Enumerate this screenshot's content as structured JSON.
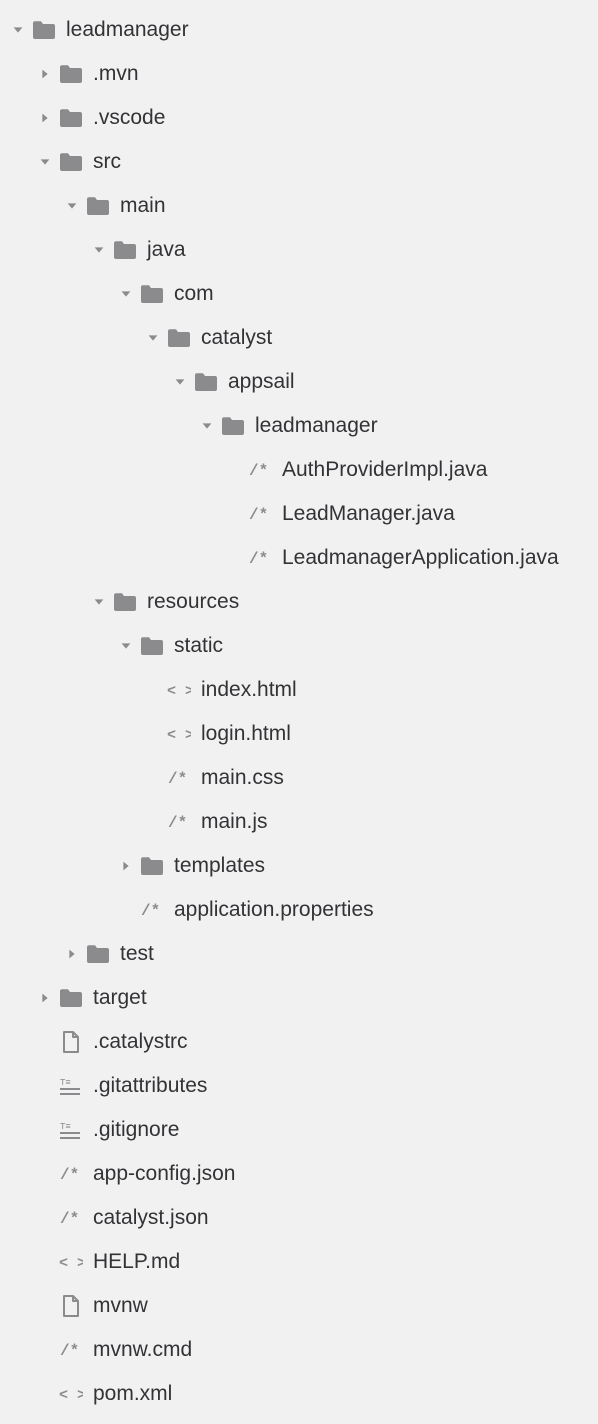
{
  "tree": [
    {
      "depth": 0,
      "expanded": true,
      "icon": "folder",
      "label": "leadmanager"
    },
    {
      "depth": 1,
      "expanded": false,
      "icon": "folder",
      "label": ".mvn"
    },
    {
      "depth": 1,
      "expanded": false,
      "icon": "folder",
      "label": ".vscode"
    },
    {
      "depth": 1,
      "expanded": true,
      "icon": "folder",
      "label": "src"
    },
    {
      "depth": 2,
      "expanded": true,
      "icon": "folder",
      "label": "main"
    },
    {
      "depth": 3,
      "expanded": true,
      "icon": "folder",
      "label": "java"
    },
    {
      "depth": 4,
      "expanded": true,
      "icon": "folder",
      "label": "com"
    },
    {
      "depth": 5,
      "expanded": true,
      "icon": "folder",
      "label": "catalyst"
    },
    {
      "depth": 6,
      "expanded": true,
      "icon": "folder",
      "label": "appsail"
    },
    {
      "depth": 7,
      "expanded": true,
      "icon": "folder",
      "label": "leadmanager"
    },
    {
      "depth": 8,
      "expanded": null,
      "icon": "code",
      "label": "AuthProviderImpl.java"
    },
    {
      "depth": 8,
      "expanded": null,
      "icon": "code",
      "label": "LeadManager.java"
    },
    {
      "depth": 8,
      "expanded": null,
      "icon": "code",
      "label": "LeadmanagerApplication.java"
    },
    {
      "depth": 3,
      "expanded": true,
      "icon": "folder",
      "label": "resources"
    },
    {
      "depth": 4,
      "expanded": true,
      "icon": "folder",
      "label": "static"
    },
    {
      "depth": 5,
      "expanded": null,
      "icon": "markup",
      "label": "index.html"
    },
    {
      "depth": 5,
      "expanded": null,
      "icon": "markup",
      "label": "login.html"
    },
    {
      "depth": 5,
      "expanded": null,
      "icon": "code",
      "label": "main.css"
    },
    {
      "depth": 5,
      "expanded": null,
      "icon": "code",
      "label": "main.js"
    },
    {
      "depth": 4,
      "expanded": false,
      "icon": "folder",
      "label": "templates"
    },
    {
      "depth": 4,
      "expanded": null,
      "icon": "code",
      "label": "application.properties"
    },
    {
      "depth": 2,
      "expanded": false,
      "icon": "folder",
      "label": "test"
    },
    {
      "depth": 1,
      "expanded": false,
      "icon": "folder",
      "label": "target"
    },
    {
      "depth": 1,
      "expanded": null,
      "icon": "file",
      "label": ".catalystrc"
    },
    {
      "depth": 1,
      "expanded": null,
      "icon": "text",
      "label": ".gitattributes"
    },
    {
      "depth": 1,
      "expanded": null,
      "icon": "text",
      "label": ".gitignore"
    },
    {
      "depth": 1,
      "expanded": null,
      "icon": "code",
      "label": "app-config.json"
    },
    {
      "depth": 1,
      "expanded": null,
      "icon": "code",
      "label": "catalyst.json"
    },
    {
      "depth": 1,
      "expanded": null,
      "icon": "markup",
      "label": "HELP.md"
    },
    {
      "depth": 1,
      "expanded": null,
      "icon": "file",
      "label": "mvnw"
    },
    {
      "depth": 1,
      "expanded": null,
      "icon": "code",
      "label": "mvnw.cmd"
    },
    {
      "depth": 1,
      "expanded": null,
      "icon": "markup",
      "label": "pom.xml"
    }
  ],
  "indentUnit": 27,
  "baseIndent": 10
}
